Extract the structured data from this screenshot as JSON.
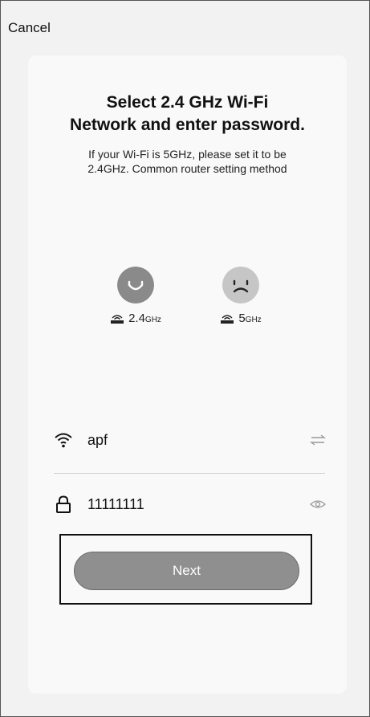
{
  "header": {
    "cancel_label": "Cancel"
  },
  "main": {
    "title_line1": "Select 2.4 GHz Wi-Fi",
    "title_line2": "Network and enter password.",
    "subtitle_line1": "If your Wi-Fi is 5GHz, please set it to be",
    "subtitle_line2": "2.4GHz. Common router setting method",
    "options": [
      {
        "value": "2.4",
        "unit": "GHz",
        "face": "smile",
        "color": "#8a8a8a"
      },
      {
        "value": "5",
        "unit": "GHz",
        "face": "frown",
        "color": "#c6c6c6"
      }
    ]
  },
  "form": {
    "ssid_value": "apf",
    "password_value": "11111111",
    "ssid_icon": "wifi-icon",
    "swap_icon": "swap-arrows-icon",
    "lock_icon": "lock-icon",
    "eye_icon": "eye-icon"
  },
  "actions": {
    "next_label": "Next"
  },
  "colors": {
    "button": "#8f8f8f",
    "card": "#f9f9f9",
    "background": "#f2f2f2"
  }
}
